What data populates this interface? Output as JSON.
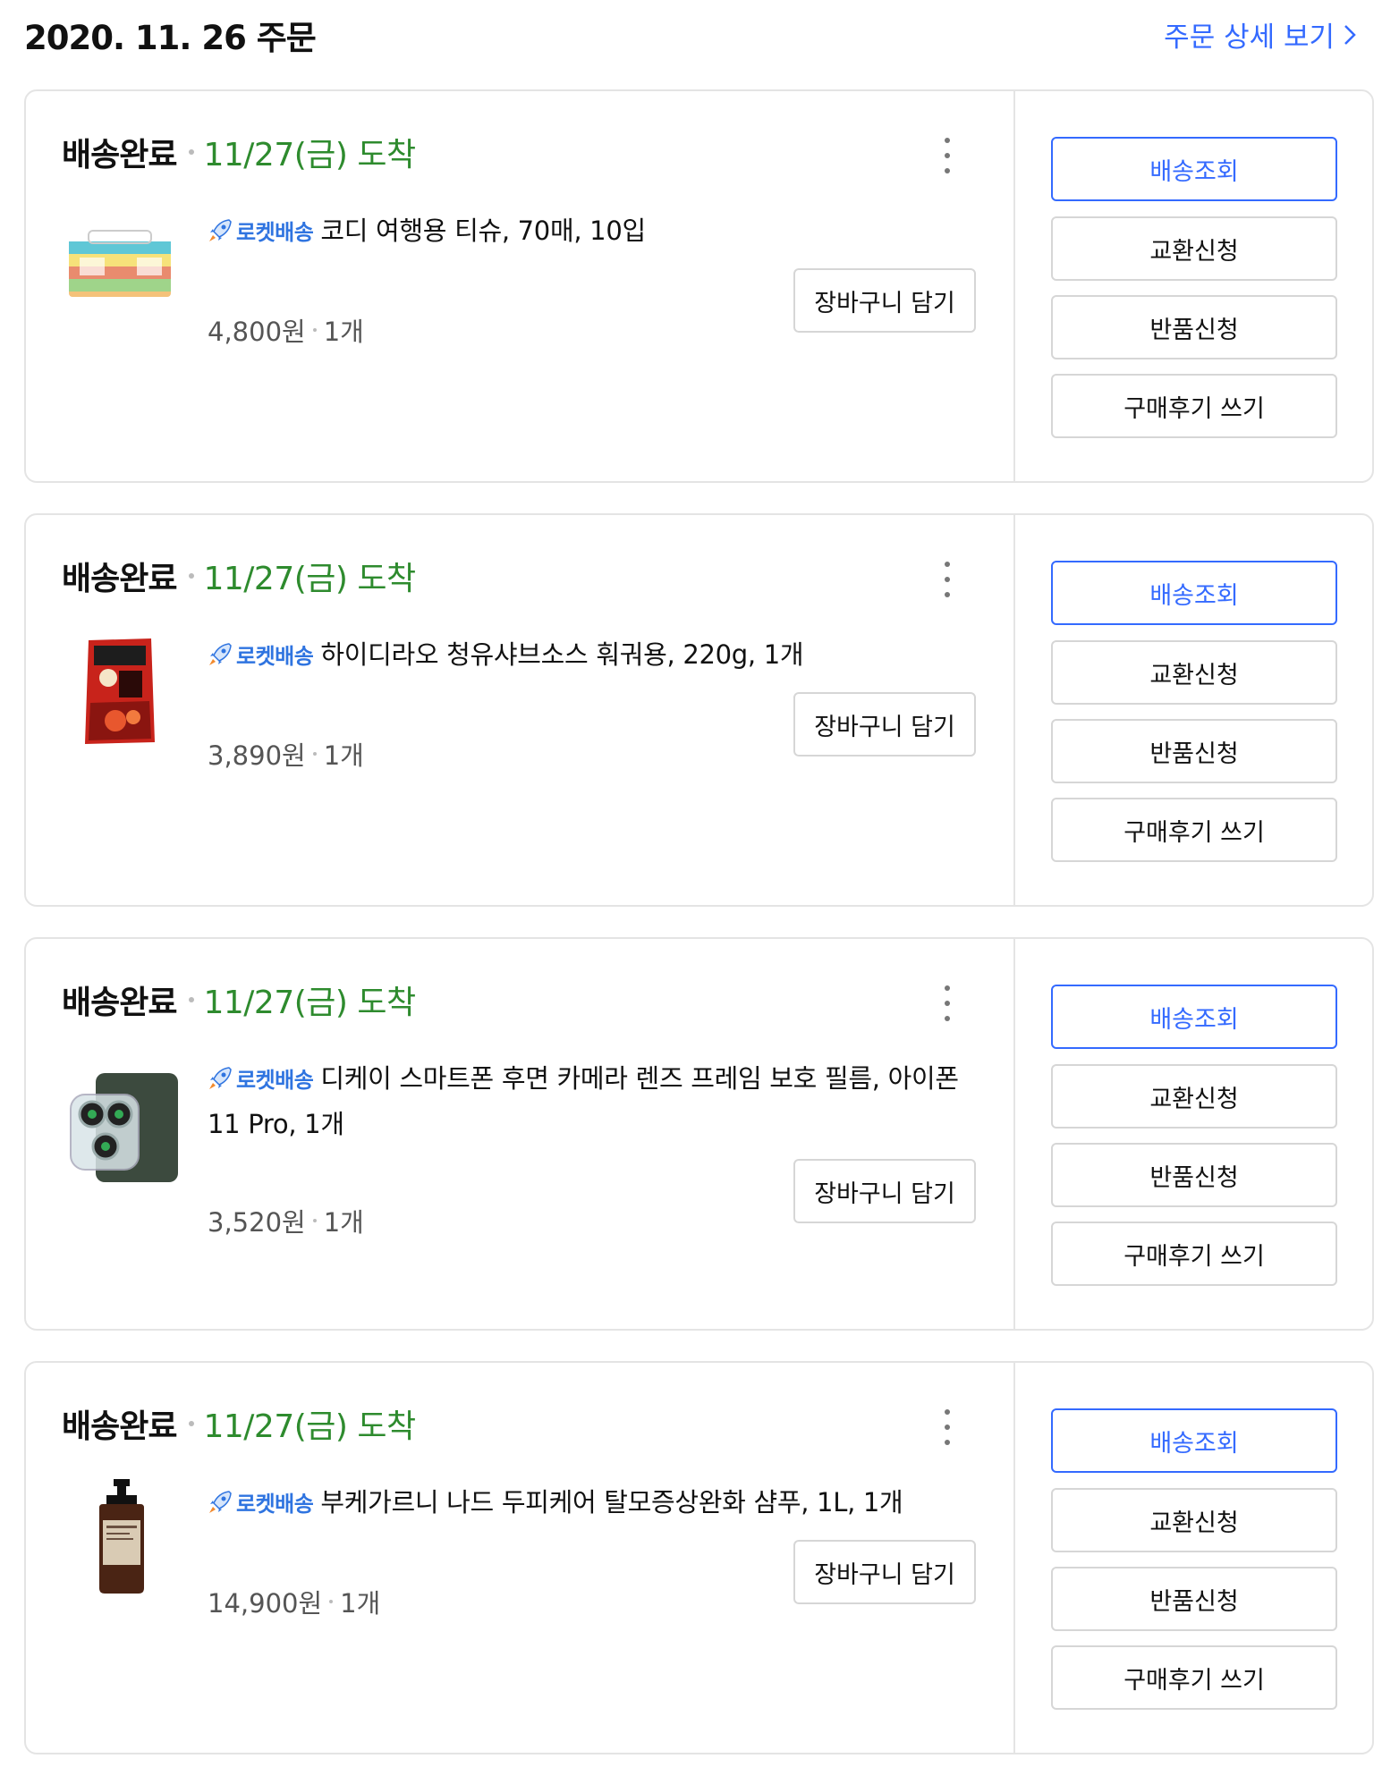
{
  "header": {
    "order_date": "2020. 11. 26 주문",
    "detail_link": "주문 상세 보기"
  },
  "rocket_label": "로켓배송",
  "orders": [
    {
      "status": "배송완료",
      "arrival": "11/27(금) 도착",
      "title": "코디 여행용 티슈, 70매, 10입",
      "price": "4,800원",
      "qty": "1개",
      "cart_label": "장바구니 담기",
      "thumb_icon": "tissue-pack-image",
      "actions": [
        "배송조회",
        "교환신청",
        "반품신청",
        "구매후기 쓰기"
      ]
    },
    {
      "status": "배송완료",
      "arrival": "11/27(금) 도착",
      "title": "하이디라오 청유샤브소스 훠궈용, 220g, 1개",
      "price": "3,890원",
      "qty": "1개",
      "cart_label": "장바구니 담기",
      "thumb_icon": "hotpot-sauce-image",
      "actions": [
        "배송조회",
        "교환신청",
        "반품신청",
        "구매후기 쓰기"
      ]
    },
    {
      "status": "배송완료",
      "arrival": "11/27(금) 도착",
      "title": "디케이 스마트폰 후면 카메라 렌즈 프레임 보호 필름, 아이폰 11 Pro, 1개",
      "price": "3,520원",
      "qty": "1개",
      "cart_label": "장바구니 담기",
      "thumb_icon": "phone-camera-film-image",
      "actions": [
        "배송조회",
        "교환신청",
        "반품신청",
        "구매후기 쓰기"
      ]
    },
    {
      "status": "배송완료",
      "arrival": "11/27(금) 도착",
      "title": "부케가르니 나드 두피케어 탈모증상완화 샴푸, 1L, 1개",
      "price": "14,900원",
      "qty": "1개",
      "cart_label": "장바구니 담기",
      "thumb_icon": "shampoo-bottle-image",
      "actions": [
        "배송조회",
        "교환신청",
        "반품신청",
        "구매후기 쓰기"
      ]
    }
  ],
  "colors": {
    "accent_blue": "#346aff",
    "arrival_green": "#2e8b2e",
    "rocket_blue": "#2f74e0",
    "border": "#e4e4e4"
  }
}
